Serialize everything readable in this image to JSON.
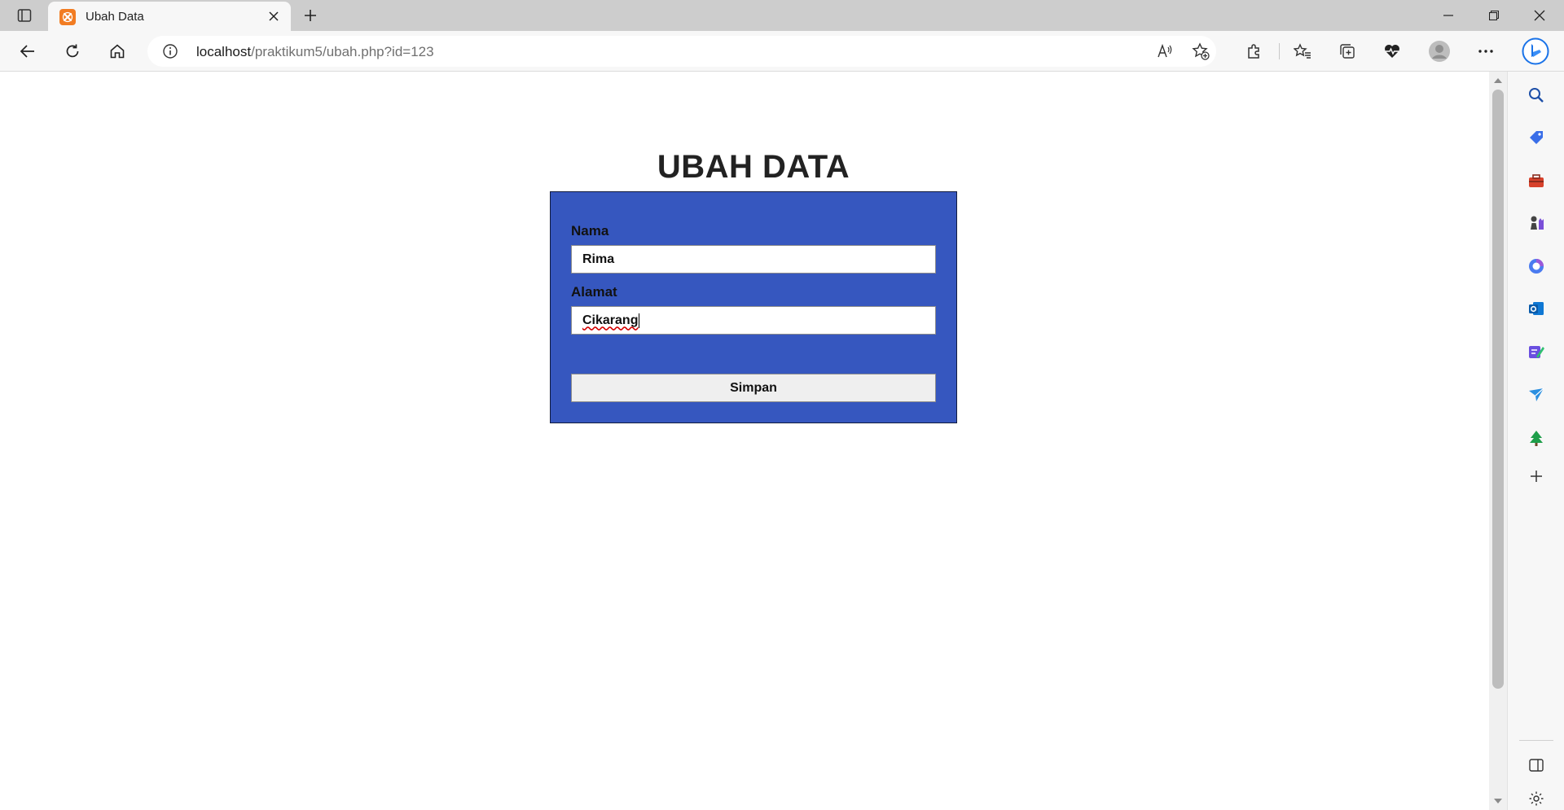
{
  "browser": {
    "tab_title": "Ubah Data",
    "address_host": "localhost",
    "address_path": "/praktikum5/ubah.php?id=123"
  },
  "page": {
    "heading": "UBAH DATA",
    "form": {
      "nama_label": "Nama",
      "nama_value": "Rima",
      "alamat_label": "Alamat",
      "alamat_value": "Cikarang",
      "submit_label": "Simpan"
    }
  },
  "colors": {
    "form_background": "#3657bf",
    "accent_tab_icon": "#f27c22"
  },
  "icons": {
    "toolbar": [
      "back-icon",
      "refresh-icon",
      "home-icon",
      "site-info-icon",
      "read-aloud-icon",
      "add-favorite-icon",
      "extensions-icon",
      "favorites-icon",
      "collections-icon",
      "health-icon",
      "profile-icon",
      "more-icon"
    ],
    "sidebar": [
      "search-icon",
      "shopping-icon",
      "tools-icon",
      "games-icon",
      "office-icon",
      "outlook-icon",
      "designer-icon",
      "send-icon",
      "tree-icon",
      "add-icon",
      "split-screen-icon",
      "settings-icon"
    ]
  }
}
